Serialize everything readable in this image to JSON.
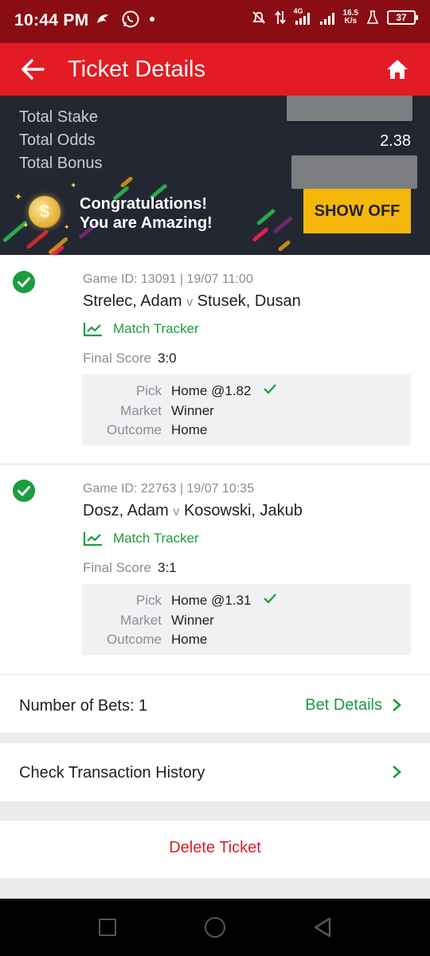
{
  "status_bar": {
    "time": "10:44 PM",
    "network_speed": "16.5",
    "network_speed_unit": "K/s",
    "battery": "37",
    "network_type": "4G"
  },
  "app_bar": {
    "title": "Ticket Details",
    "back_icon": "arrow-left-icon",
    "home_icon": "home-icon"
  },
  "summary": {
    "total_stake_label": "Total Stake",
    "total_odds_label": "Total Odds",
    "total_odds_value": "2.38",
    "total_bonus_label": "Total Bonus",
    "congrats_line1": "Congratulations!",
    "congrats_line2": "You are Amazing!",
    "show_off_label": "SHOW OFF"
  },
  "games": [
    {
      "game_id": "Game ID: 13091 | 19/07 11:00",
      "home": "Strelec, Adam",
      "vs": "v",
      "away": "Stusek, Dusan",
      "tracker_label": "Match Tracker",
      "final_score_label": "Final Score",
      "final_score": "3:0",
      "pick_label": "Pick",
      "pick_value": "Home @1.82",
      "market_label": "Market",
      "market_value": "Winner",
      "outcome_label": "Outcome",
      "outcome_value": "Home"
    },
    {
      "game_id": "Game ID: 22763 | 19/07 10:35",
      "home": "Dosz, Adam",
      "vs": "v",
      "away": "Kosowski, Jakub",
      "tracker_label": "Match Tracker",
      "final_score_label": "Final Score",
      "final_score": "3:1",
      "pick_label": "Pick",
      "pick_value": "Home @1.31",
      "market_label": "Market",
      "market_value": "Winner",
      "outcome_label": "Outcome",
      "outcome_value": "Home"
    }
  ],
  "bets": {
    "number_of_bets": "Number of Bets: 1",
    "bet_details_label": "Bet Details"
  },
  "transactions": {
    "label": "Check Transaction History"
  },
  "delete": {
    "label": "Delete Ticket"
  },
  "colors": {
    "status_bar": "#8b0d14",
    "app_bar": "#e21b24",
    "summary_bg": "#232731",
    "accent_green": "#1a9d3e",
    "show_off": "#f5b70a",
    "delete_red": "#d71f27"
  }
}
